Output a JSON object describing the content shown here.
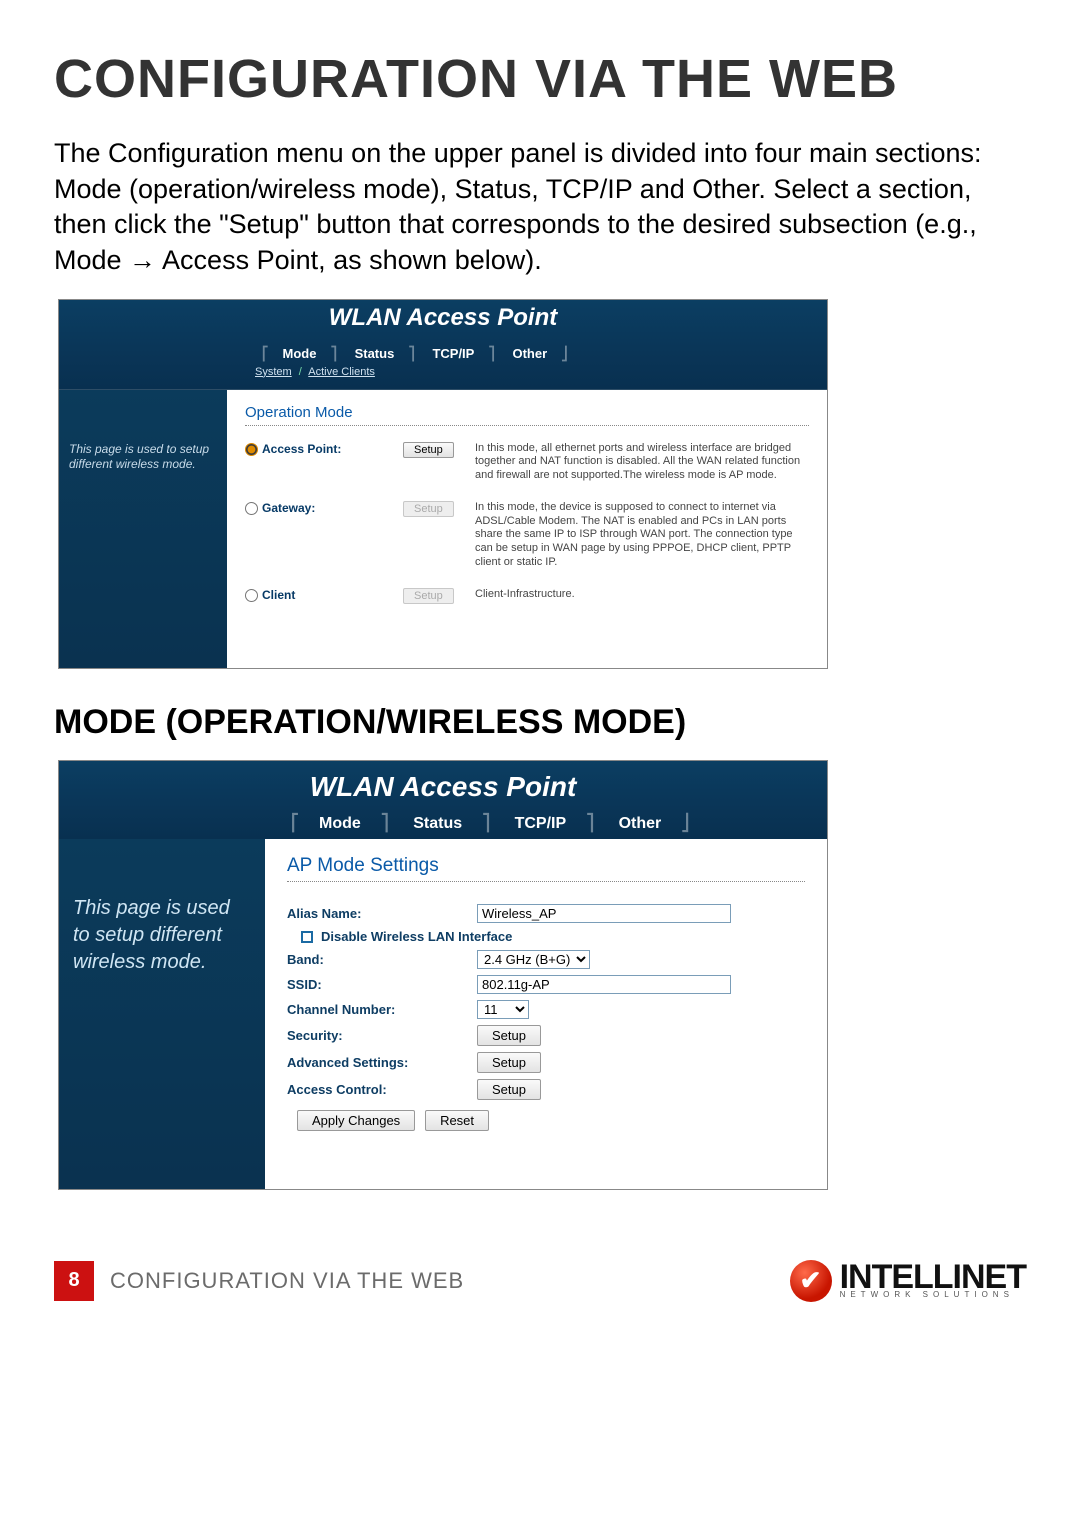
{
  "doc": {
    "title": "CONFIGURATION VIA THE WEB",
    "intro": "The Configuration menu on the upper panel is divided into four main sections: Mode (operation/wireless mode), Status, TCP/IP and Other. Select a section, then click the \"Setup\" button that corresponds to the desired subsection (e.g., Mode → Access Point, as shown below).",
    "section2_heading": "MODE (OPERATION/WIRELESS MODE)"
  },
  "shot1": {
    "brand": "WLAN Access Point",
    "tabs": {
      "mode": "Mode",
      "status": "Status",
      "tcpip": "TCP/IP",
      "other": "Other"
    },
    "subtabs": {
      "system": "System",
      "active_clients": "Active Clients"
    },
    "sidebar_note": "This page is used to setup different wireless mode.",
    "section_title": "Operation Mode",
    "rows": [
      {
        "label": "Access Point:",
        "checked": true,
        "button": "Setup",
        "enabled": true,
        "desc": "In this mode, all ethernet ports and wireless interface are bridged together and NAT function is disabled. All the WAN related function and firewall are not supported.The wireless mode is AP mode."
      },
      {
        "label": "Gateway:",
        "checked": false,
        "button": "Setup",
        "enabled": false,
        "desc": "In this mode, the device is supposed to connect to internet via ADSL/Cable Modem. The NAT is enabled and PCs in LAN ports share the same IP to ISP through WAN port. The connection type can be setup in WAN page by using PPPOE, DHCP client, PPTP client or static IP."
      },
      {
        "label": "Client",
        "checked": false,
        "button": "Setup",
        "enabled": false,
        "desc": "Client-Infrastructure."
      }
    ]
  },
  "shot2": {
    "brand": "WLAN Access Point",
    "tabs": {
      "mode": "Mode",
      "status": "Status",
      "tcpip": "TCP/IP",
      "other": "Other"
    },
    "sidebar_note": "This page is used to setup different wireless mode.",
    "section_title": "AP Mode Settings",
    "fields": {
      "alias_label": "Alias Name:",
      "alias_value": "Wireless_AP",
      "disable_wlan": "Disable Wireless LAN Interface",
      "band_label": "Band:",
      "band_value": "2.4 GHz (B+G)",
      "ssid_label": "SSID:",
      "ssid_value": "802.11g-AP",
      "channel_label": "Channel Number:",
      "channel_value": "11",
      "security_label": "Security:",
      "security_btn": "Setup",
      "adv_label": "Advanced Settings:",
      "adv_btn": "Setup",
      "access_label": "Access Control:",
      "access_btn": "Setup",
      "apply_btn": "Apply Changes",
      "reset_btn": "Reset"
    }
  },
  "footer": {
    "page_number": "8",
    "running_title": "CONFIGURATION VIA THE WEB",
    "brand_name": "INTELLINET",
    "brand_sub": "NETWORK SOLUTIONS"
  }
}
